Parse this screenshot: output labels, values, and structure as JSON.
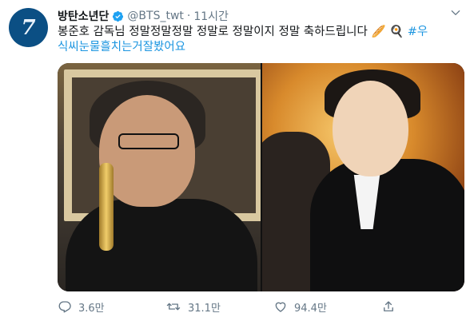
{
  "tweet": {
    "avatar_label": "7",
    "author_name": "방탄소년단",
    "handle": "@BTS_twt",
    "separator": "·",
    "time": "11시간",
    "text": "봉준호 감독님 정말정말정말 정말로 정말이지 정말 축하드립니다",
    "emojis": "🥖 🍳",
    "hashtag": "#우식씨눈물흘치는거잘봤어요",
    "hashtag_line1": "#우",
    "hashtag_line2": "식씨눈물흘치는거잘봤어요",
    "stats": {
      "replies": "3.6만",
      "retweets": "31.1만",
      "likes": "94.4만"
    },
    "colors": {
      "accent": "#1b95e0",
      "verified": "#1da1f2",
      "avatar_bg": "#0b4f84",
      "muted": "#657786"
    },
    "icons": {
      "verified": "verified-badge-icon",
      "caret": "chevron-down-icon",
      "reply": "reply-icon",
      "retweet": "retweet-icon",
      "like": "heart-icon",
      "share": "share-icon"
    }
  }
}
